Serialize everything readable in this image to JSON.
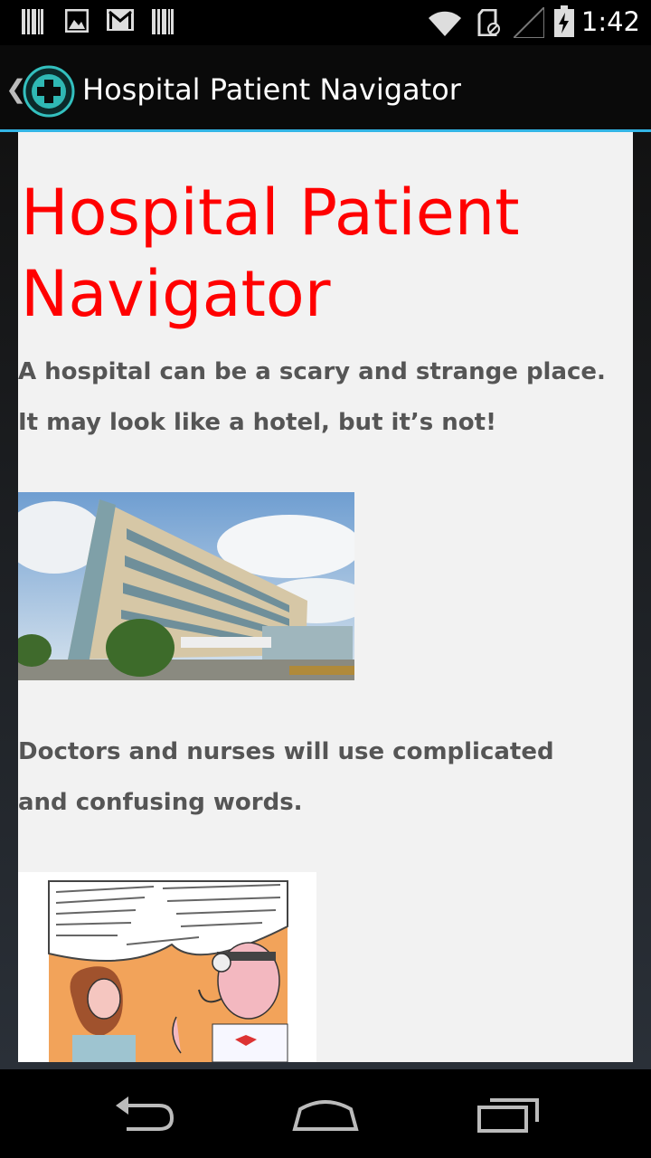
{
  "status_bar": {
    "time": "1:42",
    "icons": [
      "barcode-icon",
      "image-icon",
      "gmail-icon",
      "barcode-icon",
      "wifi-icon",
      "sd-card-icon",
      "signal-icon",
      "battery-icon"
    ]
  },
  "action_bar": {
    "title": "Hospital Patient Navigator",
    "back_glyph": "❮",
    "accent_color": "#33b5e5"
  },
  "content": {
    "heading": "Hospital Patient Navigator",
    "heading_color": "#ff0000",
    "intro": "A hospital can be a scary and strange place. It may look like a hotel, but it’s not!",
    "doctors": "Doctors and nurses will use complicated and confusing words."
  },
  "nav_bar": {
    "buttons": [
      "back-icon",
      "home-icon",
      "recent-apps-icon"
    ]
  }
}
